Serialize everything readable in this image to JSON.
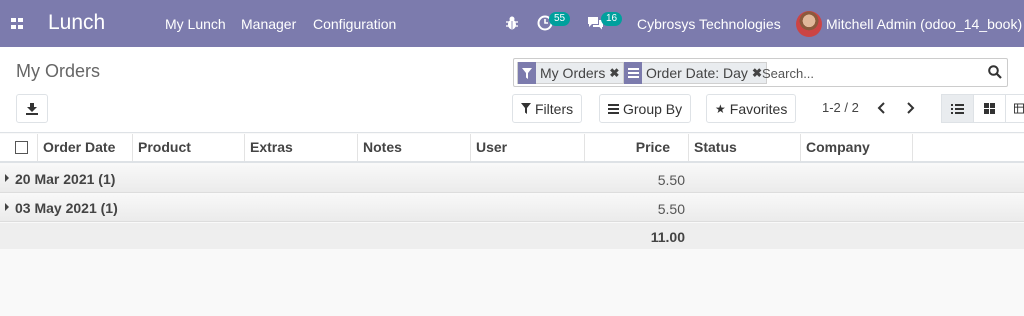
{
  "navbar": {
    "app_name": "Lunch",
    "menu": [
      "My Lunch",
      "Manager",
      "Configuration"
    ],
    "activity_count": "55",
    "message_count": "16",
    "company": "Cybrosys Technologies",
    "user": "Mitchell Admin (odoo_14_book)",
    "bg_color": "#7c7bad",
    "badge_color": "#00a09d"
  },
  "control_panel": {
    "title": "My Orders",
    "facets": [
      {
        "label": "My Orders",
        "icon": "filter-icon"
      },
      {
        "label": "Order Date: Day",
        "icon": "group-by-icon"
      }
    ],
    "search_placeholder": "Search...",
    "filters_label": "Filters",
    "group_by_label": "Group By",
    "favorites_label": "Favorites",
    "pager": "1-2 / 2"
  },
  "table": {
    "columns": [
      "Order Date",
      "Product",
      "Extras",
      "Notes",
      "User",
      "Price",
      "Status",
      "Company"
    ],
    "groups": [
      {
        "label": "20 Mar 2021 (1)",
        "price": "5.50"
      },
      {
        "label": "03 May 2021 (1)",
        "price": "5.50"
      }
    ],
    "total": "11.00"
  }
}
